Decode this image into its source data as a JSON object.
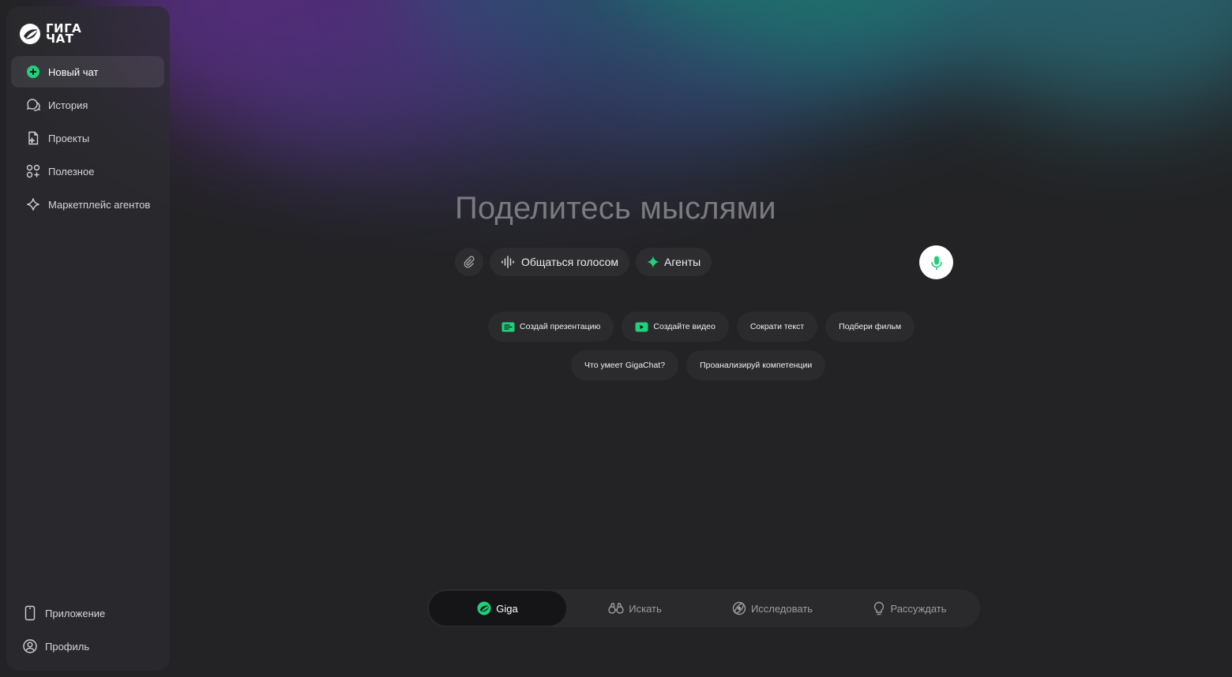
{
  "app": {
    "logo_text_line1": "ГИГА",
    "logo_text_line2": "ЧАТ",
    "accent": "#21d07a"
  },
  "sidebar": {
    "items": [
      {
        "label": "Новый чат",
        "icon": "plus-circle-icon",
        "active": true
      },
      {
        "label": "История",
        "icon": "chat-bubbles-icon"
      },
      {
        "label": "Проекты",
        "icon": "document-sparkle-icon"
      },
      {
        "label": "Полезное",
        "icon": "grid-plus-icon"
      },
      {
        "label": "Маркетплейс агентов",
        "icon": "sparkle-icon"
      }
    ],
    "bottom": [
      {
        "label": "Приложение",
        "icon": "phone-icon"
      },
      {
        "label": "Профиль",
        "icon": "user-circle-icon"
      }
    ]
  },
  "composer": {
    "placeholder": "Поделитесь мыслями",
    "voice_label": "Общаться голосом",
    "agents_label": "Агенты"
  },
  "suggestions": {
    "row1": [
      "Создай презентацию",
      "Создайте видео",
      "Сократи текст",
      "Подбери фильм"
    ],
    "row2": [
      "Что умеет GigaChat?",
      "Проанализируй компетенции"
    ]
  },
  "modes": [
    {
      "label": "Giga",
      "active": true
    },
    {
      "label": "Искать"
    },
    {
      "label": "Исследовать"
    },
    {
      "label": "Рассуждать"
    }
  ]
}
